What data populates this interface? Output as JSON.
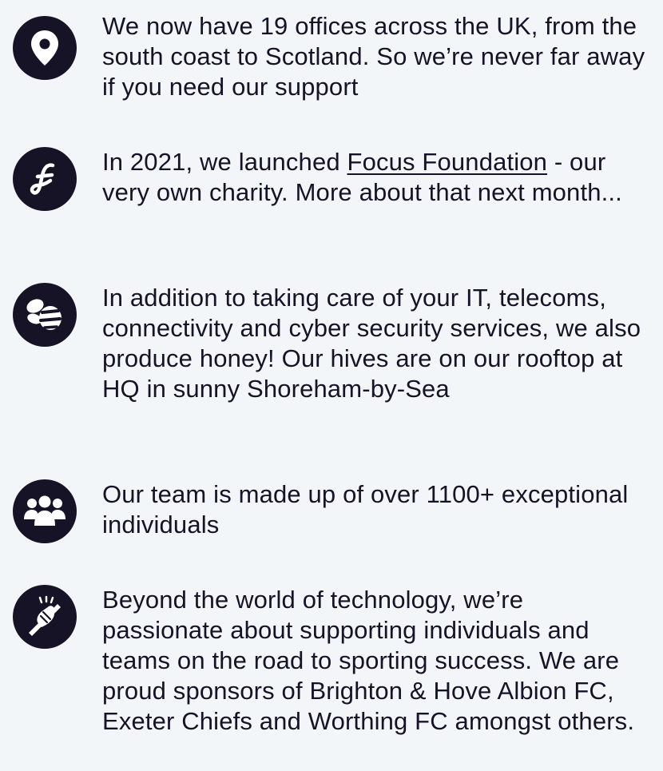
{
  "items": [
    {
      "icon": "location-pin-icon",
      "text": "We now have 19 offices across the UK, from the south coast to Scotland. So we’re never far away if you need our support"
    },
    {
      "icon": "focus-foundation-logo-icon",
      "text_before": "In 2021, we launched ",
      "link": "Focus Foundation",
      "text_after": " - our very own charity. More about that next month..."
    },
    {
      "icon": "bee-icon",
      "text": "In addition to taking care of your IT, telecoms, connectivity and cyber security services, we also produce honey! Our hives are on our rooftop at HQ in sunny Shoreham-by-Sea"
    },
    {
      "icon": "team-people-icon",
      "text": "Our team is made up of over 1100+ exceptional individuals"
    },
    {
      "icon": "handshake-icon",
      "text": "Beyond the world of technology, we’re passionate about supporting individuals and teams on the road to sporting success. We are proud sponsors of Brighton & Hove Albion FC, Exeter Chiefs and Worthing FC amongst others."
    }
  ],
  "colors": {
    "background": "#f3f6f9",
    "icon_circle": "#161327",
    "text": "#161327",
    "icon_glyph": "#ffffff"
  }
}
